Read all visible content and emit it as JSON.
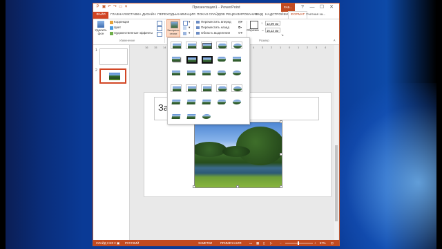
{
  "window": {
    "title": "Презентация1 - PowerPoint",
    "tools_label": "РАБ...",
    "account": "Учетная за...",
    "controls": [
      "?",
      "—",
      "☐",
      "✕"
    ]
  },
  "tabs": [
    {
      "label": "ФАЙЛ"
    },
    {
      "label": "ГЛАВНАЯ"
    },
    {
      "label": "ВСТАВКА"
    },
    {
      "label": "ДИЗАЙН"
    },
    {
      "label": "ПЕРЕХОДЫ"
    },
    {
      "label": "АНИМАЦИЯ"
    },
    {
      "label": "ПОКАЗ СЛАЙДОВ"
    },
    {
      "label": "РЕЦЕНЗИРОВАНИЕ"
    },
    {
      "label": "ВИД"
    },
    {
      "label": "НАДСТРОЙКИ"
    },
    {
      "label": "ФОРМАТ"
    }
  ],
  "ribbon": {
    "remove_bg": "Удалить фон",
    "correction": "Коррекция",
    "color": "Цвет",
    "artistic": "Художественные эффекты",
    "group_adjust": "Изменение",
    "express_styles": "Экспресс-стили",
    "bring_forward": "Переместить вперед",
    "send_backward": "Переместить назад",
    "selection_pane": "Область выделения",
    "crop": "Обрезка",
    "height": "12,09 см",
    "width": "16,12 см",
    "group_size": "Размер"
  },
  "ruler_ticks": [
    "16",
    "15",
    "14",
    "13",
    "12",
    "11",
    "10",
    "9",
    "8",
    "7",
    "6",
    "5",
    "4",
    "3",
    "2",
    "1",
    "0",
    "1",
    "2",
    "3",
    "4"
  ],
  "slides": [
    {
      "number": "1"
    },
    {
      "number": "2"
    }
  ],
  "slide": {
    "title_placeholder": "За"
  },
  "status": {
    "slide_info": "СЛАЙД 2 ИЗ 2",
    "language": "РУССКИЙ",
    "notes": "ЗАМЕТКИ",
    "comments": "ПРИМЕЧАНИЯ",
    "zoom": "57%"
  },
  "colors": {
    "accent": "#c24a20",
    "file_tab": "#d04423",
    "selected_style_bg": "#fbd7c1"
  }
}
